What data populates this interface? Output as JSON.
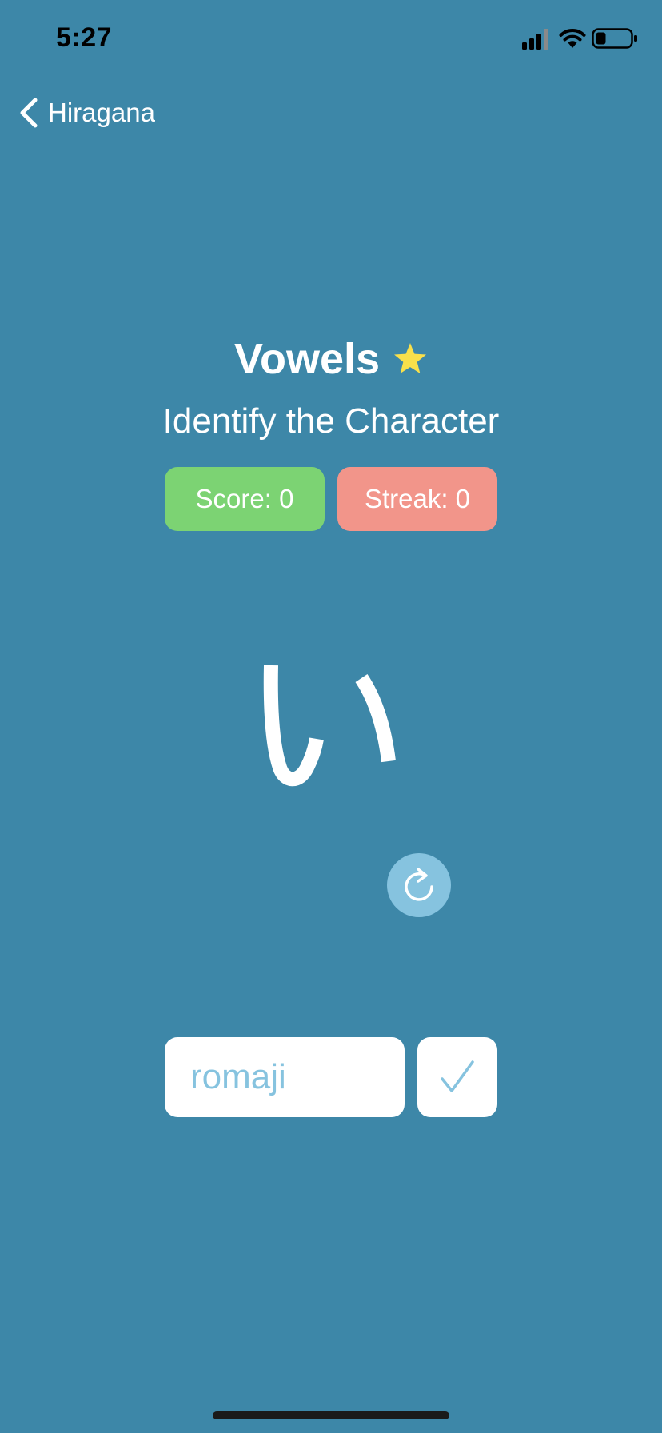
{
  "status_bar": {
    "time": "5:27",
    "icons": [
      "signal-icon",
      "wifi-icon",
      "battery-icon"
    ]
  },
  "nav": {
    "back_label": "Hiragana",
    "back_icon": "chevron-left-icon"
  },
  "quiz": {
    "title": "Vowels",
    "title_icon": "star-icon",
    "star_color": "#F9E04B",
    "subtitle": "Identify the Character",
    "character": "い",
    "refresh_icon": "refresh-icon"
  },
  "stats": {
    "score_label": "Score: 0",
    "streak_label": "Streak: 0",
    "score_color": "#7CD373",
    "streak_color": "#F2958A"
  },
  "answer": {
    "placeholder": "romaji",
    "value": "",
    "submit_icon": "checkmark-icon"
  },
  "colors": {
    "background": "#3D87A8",
    "accent_light": "#86C3DF",
    "text": "#FFFFFF"
  }
}
